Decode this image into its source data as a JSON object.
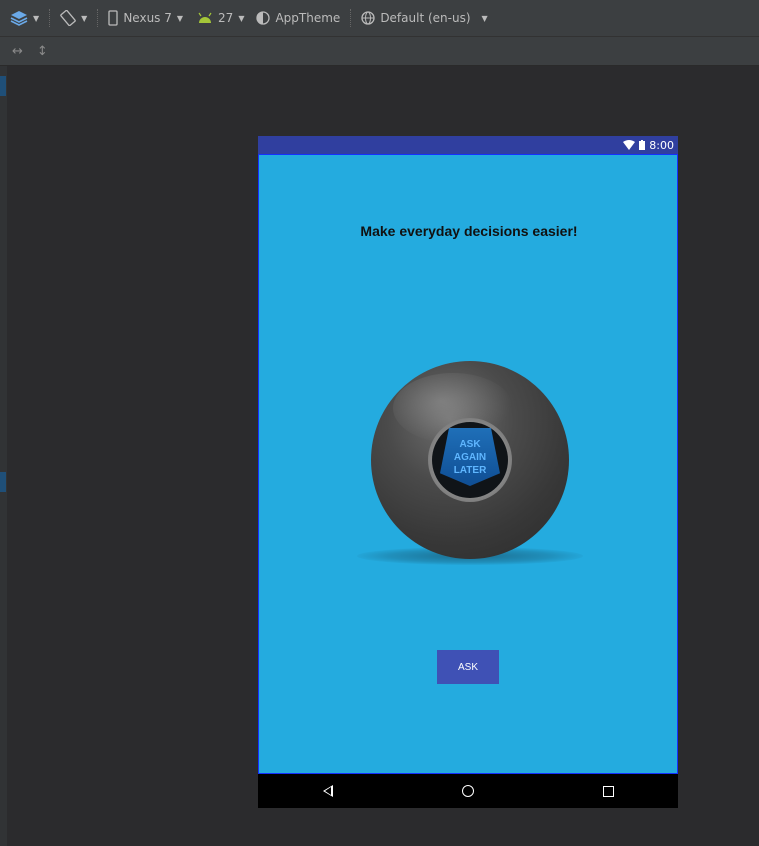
{
  "toolbar": {
    "device": "Nexus 7",
    "api_level": "27",
    "theme": "AppTheme",
    "locale": "Default (en-us)"
  },
  "device": {
    "status_time": "8:00"
  },
  "app": {
    "headline": "Make everyday decisions easier!",
    "answer_lines": [
      "ASK",
      "AGAIN",
      "LATER"
    ],
    "ask_button": "ASK",
    "background_color": "#24abdf",
    "button_color": "#3f51b5",
    "statusbar_color": "#303f9f"
  }
}
